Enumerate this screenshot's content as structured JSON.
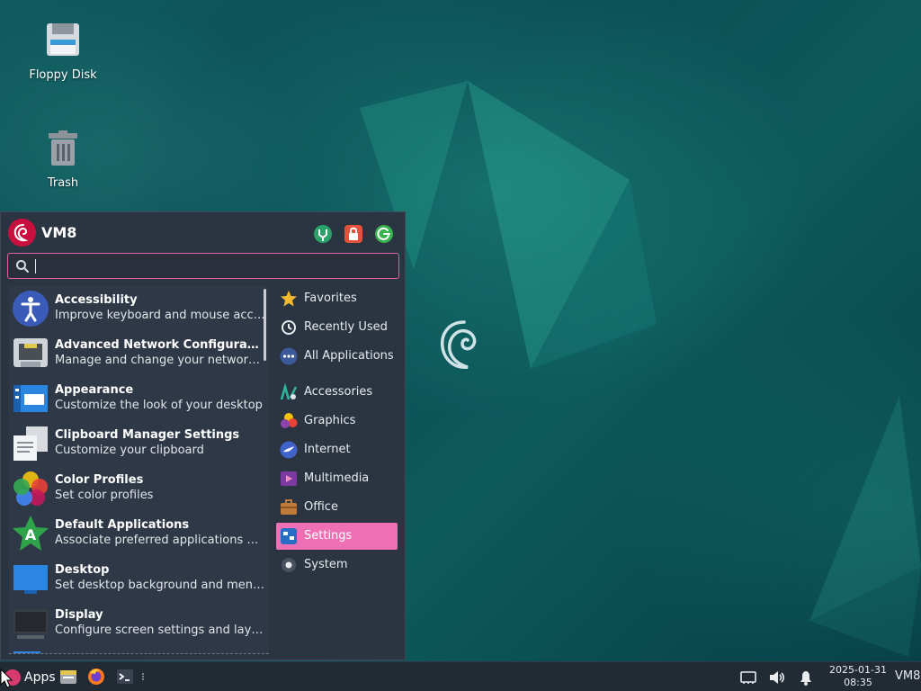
{
  "desktop": {
    "icons": [
      {
        "label": "Floppy Disk",
        "icon": "floppy-disk-icon"
      },
      {
        "label": "Trash",
        "icon": "trash-icon"
      }
    ]
  },
  "menu": {
    "username": "VM8",
    "header_buttons": [
      "settings-manager-icon",
      "lock-screen-icon",
      "log-out-icon"
    ],
    "search": {
      "value": "",
      "placeholder": ""
    },
    "apps": [
      {
        "name": "Accessibility",
        "desc": "Improve keyboard and mouse acc…",
        "icon": "accessibility-icon"
      },
      {
        "name": "Advanced Network Configura…",
        "desc": "Manage and change your networ…",
        "icon": "network-icon"
      },
      {
        "name": "Appearance",
        "desc": "Customize the look of your desktop",
        "icon": "appearance-icon"
      },
      {
        "name": "Clipboard Manager Settings",
        "desc": "Customize your clipboard",
        "icon": "clipboard-icon"
      },
      {
        "name": "Color Profiles",
        "desc": "Set color profiles",
        "icon": "color-profiles-icon"
      },
      {
        "name": "Default Applications",
        "desc": "Associate preferred applications …",
        "icon": "default-apps-icon"
      },
      {
        "name": "Desktop",
        "desc": "Set desktop background and men…",
        "icon": "desktop-icon"
      },
      {
        "name": "Display",
        "desc": "Configure screen settings and lay…",
        "icon": "display-icon"
      },
      {
        "name": "",
        "desc": "",
        "icon": "partial-row-icon"
      }
    ],
    "categories": [
      {
        "label": "Favorites",
        "icon": "star-icon"
      },
      {
        "label": "Recently Used",
        "icon": "clock-icon"
      },
      {
        "label": "All Applications",
        "icon": "all-apps-icon"
      },
      {
        "label": "Accessories",
        "icon": "accessories-icon"
      },
      {
        "label": "Graphics",
        "icon": "graphics-icon"
      },
      {
        "label": "Internet",
        "icon": "internet-icon"
      },
      {
        "label": "Multimedia",
        "icon": "multimedia-icon"
      },
      {
        "label": "Office",
        "icon": "office-icon"
      },
      {
        "label": "Settings",
        "icon": "settings-icon",
        "active": true
      },
      {
        "label": "System",
        "icon": "system-icon"
      }
    ]
  },
  "taskbar": {
    "apps_label": "Apps",
    "clock": {
      "date": "2025-01-31",
      "time": "08:35"
    },
    "hostname": "VM8"
  },
  "colors": {
    "accent": "#ee6fb3",
    "menu_bg": "#2b3441",
    "panel_bg": "#222a34"
  }
}
